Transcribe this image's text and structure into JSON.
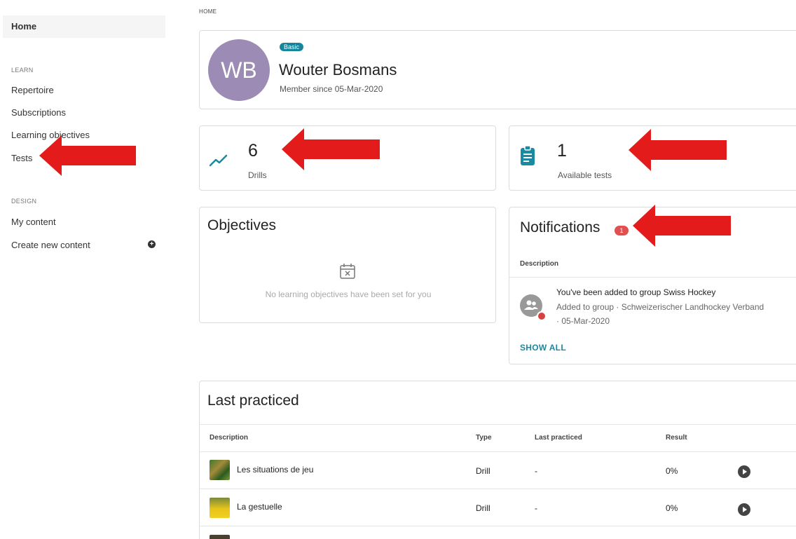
{
  "sidebar": {
    "home": "Home",
    "learn_section": "LEARN",
    "learn_items": [
      "Repertoire",
      "Subscriptions",
      "Learning objectives",
      "Tests"
    ],
    "design_section": "DESIGN",
    "design_items": [
      "My content",
      "Create new content"
    ]
  },
  "breadcrumb": "HOME",
  "profile": {
    "initials": "WB",
    "badge": "Basic",
    "name": "Wouter Bosmans",
    "member_since": "Member since 05-Mar-2020",
    "avatar_color": "#9b8bb5"
  },
  "stats": {
    "drills": {
      "value": "6",
      "label": "Drills",
      "icon": "trend-line-icon"
    },
    "tests": {
      "value": "1",
      "label": "Available tests",
      "icon": "clipboard-icon"
    }
  },
  "objectives": {
    "title": "Objectives",
    "empty_text": "No learning objectives have been set for you",
    "icon": "calendar-x-icon"
  },
  "notifications": {
    "title": "Notifications",
    "count": "1",
    "column": "Description",
    "item": {
      "title": "You've been added to group Swiss Hockey",
      "line1": "Added to group · Schweizerischer Landhockey Verband",
      "line2": "· 05-Mar-2020"
    },
    "show_all": "SHOW ALL"
  },
  "last_practiced": {
    "title": "Last practiced",
    "columns": [
      "Description",
      "Type",
      "Last practiced",
      "Result"
    ],
    "rows": [
      {
        "description": "Les situations de jeu",
        "type": "Drill",
        "last": "-",
        "result": "0%"
      },
      {
        "description": "La gestuelle",
        "type": "Drill",
        "last": "-",
        "result": "0%"
      }
    ]
  },
  "colors": {
    "accent": "#1a8aa0",
    "badge": "#17869a",
    "notification_badge": "#e05050",
    "annotation_arrow": "#e31b1b"
  }
}
